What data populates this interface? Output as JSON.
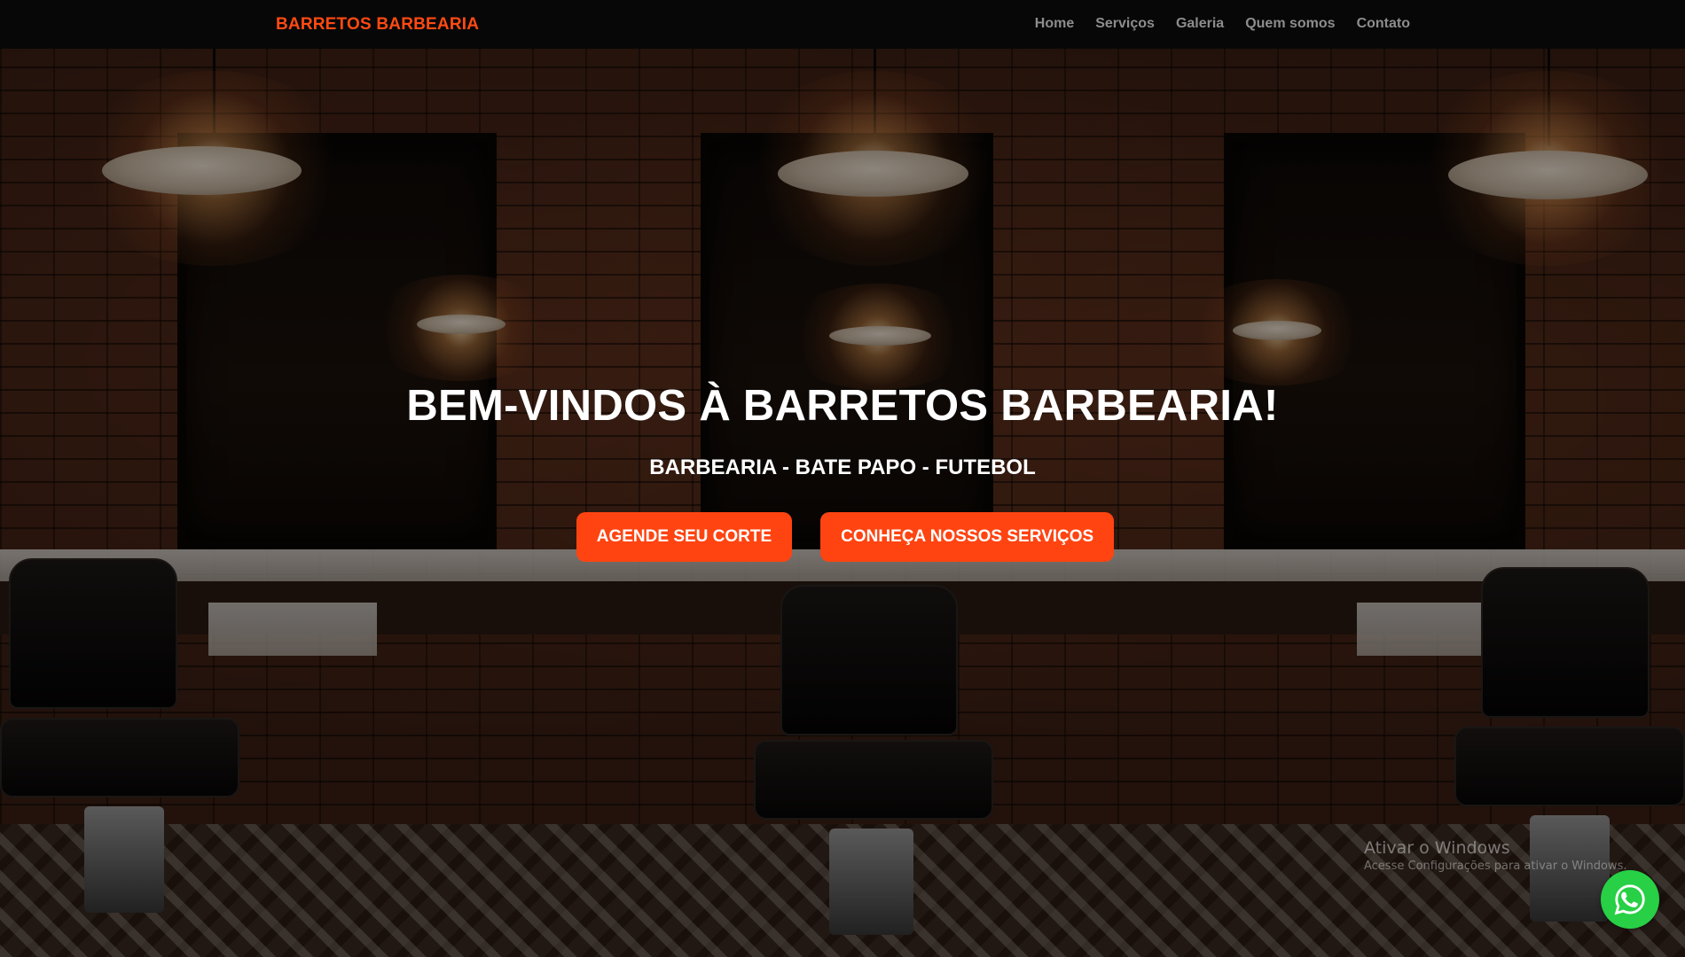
{
  "navbar": {
    "brand": "BARRETOS BARBEARIA",
    "links": [
      "Home",
      "Serviços",
      "Galeria",
      "Quem somos",
      "Contato"
    ]
  },
  "hero": {
    "title": "BEM-VINDOS À BARRETOS BARBEARIA!",
    "subtitle": "BARBEARIA - BATE PAPO - FUTEBOL",
    "buttons": {
      "primary": "AGENDE SEU CORTE",
      "secondary": "CONHEÇA NOSSOS SERVIÇOS"
    },
    "background_image": "barbershop-interior"
  },
  "watermark": {
    "title": "Ativar o Windows",
    "subtitle": "Acesse Configurações para ativar o Windows."
  },
  "floating_action": {
    "icon": "whatsapp-icon"
  },
  "colors": {
    "accent": "#ff4411",
    "brand": "#ff4a12",
    "nav_bg": "#070707",
    "nav_link": "#8d8d8d",
    "whatsapp": "#27d045"
  }
}
